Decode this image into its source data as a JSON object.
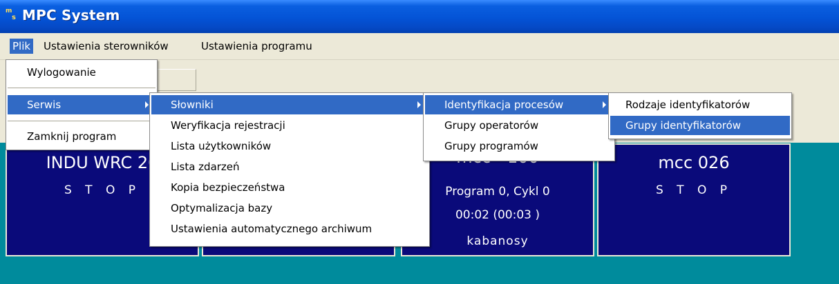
{
  "window": {
    "title": "MPC System"
  },
  "menubar": [
    {
      "label": "Plik"
    },
    {
      "label": "Ustawienia sterowników"
    },
    {
      "label": "Ustawienia programu"
    }
  ],
  "menu_plik": {
    "items": [
      {
        "label": "Wylogowanie"
      },
      {
        "label": "Serwis"
      },
      {
        "label": "Zamknij program"
      }
    ]
  },
  "menu_serwis": {
    "items": [
      {
        "label": "Słowniki"
      },
      {
        "label": "Weryfikacja rejestracji"
      },
      {
        "label": "Lista użytkowników"
      },
      {
        "label": "Lista zdarzeń"
      },
      {
        "label": "Kopia bezpieczeństwa"
      },
      {
        "label": "Optymalizacja bazy"
      },
      {
        "label": "Ustawienia automatycznego archiwum"
      }
    ]
  },
  "menu_slowniki": {
    "items": [
      {
        "label": "Identyfikacja procesów"
      },
      {
        "label": "Grupy operatorów"
      },
      {
        "label": "Grupy programów"
      }
    ]
  },
  "menu_identyfikacja": {
    "items": [
      {
        "label": "Rodzaje identyfikatorów"
      },
      {
        "label": "Grupy identyfikatorów"
      }
    ]
  },
  "tiles": [
    {
      "name": "INDU WRC 20",
      "status": "S T O P"
    },
    {
      "name": ""
    },
    {
      "name": "mcc - 100",
      "program": "Program 0, Cykl 0",
      "time": "00:02  (00:03 )",
      "product": "kabanosy"
    },
    {
      "name": "mcc 026",
      "status": "S T O P"
    }
  ],
  "colors": {
    "titlebar": "#0453D6",
    "menu_highlight": "#316AC5",
    "tile_bg": "#0A0A7A",
    "content_bg": "#008B9C"
  }
}
